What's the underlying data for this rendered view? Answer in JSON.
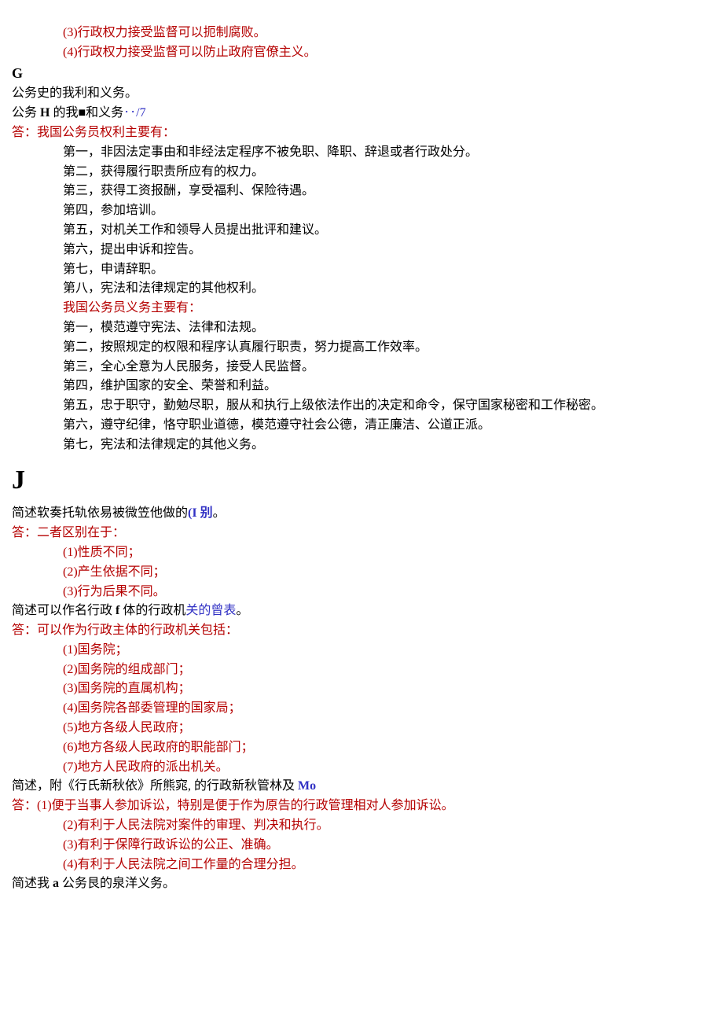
{
  "top": {
    "l1": "(3)行政权力接受监督可以扼制腐败。",
    "l2": "(4)行政权力接受监督可以防止政府官僚主义。"
  },
  "g": {
    "letter": "G",
    "t1": "公务史的我利和义务。",
    "t2a": "公务 ",
    "t2b": "H",
    "t2c": " 的我■和义务",
    "t2d": "‥/7",
    "a_label": "答：",
    "a_head": "我国公务员权利主要有：",
    "r1": "第一，非因法定事由和非经法定程序不被免职、降职、辞退或者行政处分。",
    "r2": "第二，获得履行职责所应有的权力。",
    "r3": "第三，获得工资报酬，享受福利、保险待遇。",
    "r4": "第四，参加培训。",
    "r5": "第五，对机关工作和领导人员提出批评和建议。",
    "r6": "第六，提出申诉和控告。",
    "r7": "第七，申请辞职。",
    "r8": "第八，宪法和法律规定的其他权利。",
    "d_head": "我国公务员义务主要有：",
    "d1": "第一，模范遵守宪法、法律和法规。",
    "d2": "第二，按照规定的权限和程序认真履行职责，努力提高工作效率。",
    "d3": "第三，全心全意为人民服务，接受人民监督。",
    "d4": "第四，维护国家的安全、荣誉和利益。",
    "d5": "第五，忠于职守，勤勉尽职，服从和执行上级依法作出的决定和命令，保守国家秘密和工作秘密。",
    "d6": "第六，遵守纪律，恪守职业道德，模范遵守社会公德，清正廉洁、公道正派。",
    "d7": "第七，宪法和法律规定的其他义务。"
  },
  "j": {
    "letter": "J",
    "q1a": "简述软奏托轨依易被微笠他做的",
    "q1b": "(I 别",
    "q1c": "。",
    "a1_label": "答：",
    "a1_head": "二者区别在于：",
    "a1_1": "(1)性质不同；",
    "a1_2": "(2)产生依据不同；",
    "a1_3": "(3)行为后果不同。",
    "q2a": "简述可以作名行政 ",
    "q2b": "f",
    "q2c": " 体的行政机",
    "q2d": "关的",
    "q2e": "曾表",
    "q2f": "。",
    "a2_label": "答：",
    "a2_head": "可以作为行政主体的行政机关包括：",
    "a2_1": "(1)国务院；",
    "a2_2": "(2)国务院的组成部门；",
    "a2_3": "(3)国务院的直属机构；",
    "a2_4": "(4)国务院各部委管理的国家局；",
    "a2_5": "(5)地方各级人民政府；",
    "a2_6": "(6)地方各级人民政府的职能部门；",
    "a2_7": "(7)地方人民政府的派出机关。",
    "q3a": "简述，附《行氏新秋依》所熊窕, 的行政新秋管林及 ",
    "q3b": "Mo",
    "a3_label": "答：",
    "a3_1": "(1)便于当事人参加诉讼，特别是便于作为原告的行政管理相对人参加诉讼。",
    "a3_2": "(2)有利于人民法院对案件的审理、判决和执行。",
    "a3_3": "(3)有利于保障行政诉讼的公正、准确。",
    "a3_4": "(4)有利于人民法院之间工作量的合理分担。",
    "q4a": "简述我 ",
    "q4b": "a",
    "q4c": " 公务艮的泉洋义务。"
  }
}
